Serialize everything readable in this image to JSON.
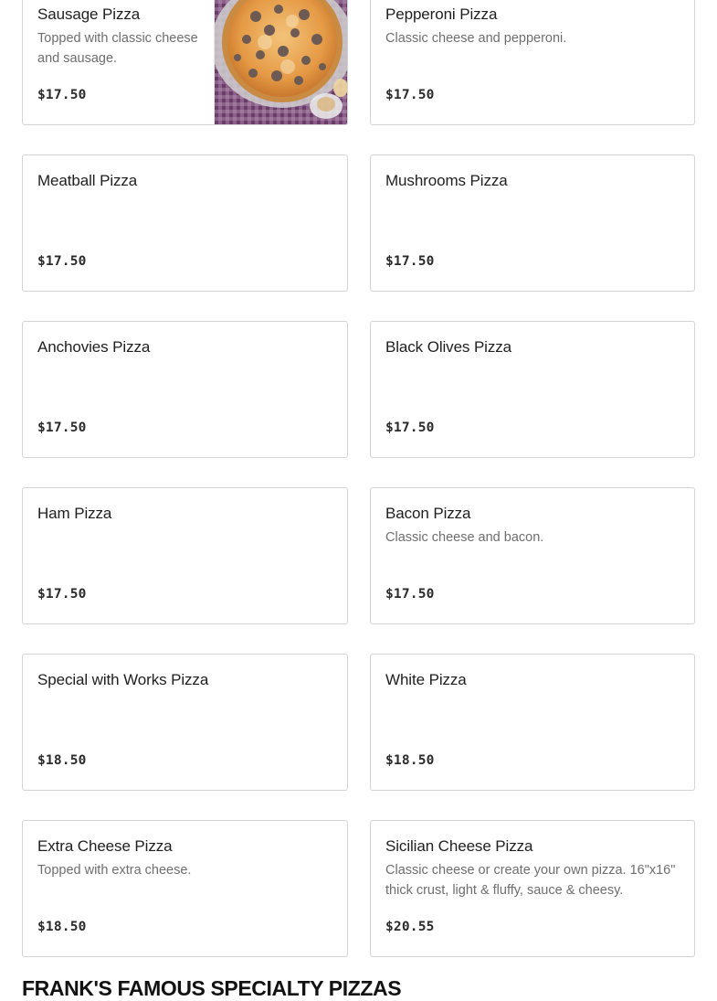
{
  "menu_items": [
    {
      "name": "Sausage Pizza",
      "description": "Topped with classic cheese and sausage.",
      "price": "$17.50",
      "has_image": true
    },
    {
      "name": "Pepperoni Pizza",
      "description": "Classic cheese and pepperoni.",
      "price": "$17.50",
      "has_image": false
    },
    {
      "name": "Meatball Pizza",
      "description": "",
      "price": "$17.50",
      "has_image": false
    },
    {
      "name": "Mushrooms Pizza",
      "description": "",
      "price": "$17.50",
      "has_image": false
    },
    {
      "name": "Anchovies Pizza",
      "description": "",
      "price": "$17.50",
      "has_image": false
    },
    {
      "name": "Black Olives Pizza",
      "description": "",
      "price": "$17.50",
      "has_image": false
    },
    {
      "name": "Ham Pizza",
      "description": "",
      "price": "$17.50",
      "has_image": false
    },
    {
      "name": "Bacon Pizza",
      "description": "Classic cheese and bacon.",
      "price": "$17.50",
      "has_image": false
    },
    {
      "name": "Special with Works Pizza",
      "description": "",
      "price": "$18.50",
      "has_image": false
    },
    {
      "name": "White Pizza",
      "description": "",
      "price": "$18.50",
      "has_image": false
    },
    {
      "name": "Extra Cheese Pizza",
      "description": "Topped with extra cheese.",
      "price": "$18.50",
      "has_image": false
    },
    {
      "name": "Sicilian Cheese Pizza",
      "description": "Classic cheese or create your own pizza. 16\"x16\" thick crust, light & fluffy, sauce & cheesy.",
      "price": "$20.55",
      "has_image": false
    }
  ],
  "next_section": {
    "title": "FRANK'S FAMOUS SPECIALTY PIZZAS"
  },
  "colors": {
    "card_border": "#d4d4d4",
    "name_text": "#1f1f1f",
    "description_text": "#6e6e6e",
    "price_text": "#2a2a2a",
    "tablecloth": "#8a5a86",
    "pizza_crust": "#d9a25a",
    "pizza_sauce": "#e08a3a"
  }
}
